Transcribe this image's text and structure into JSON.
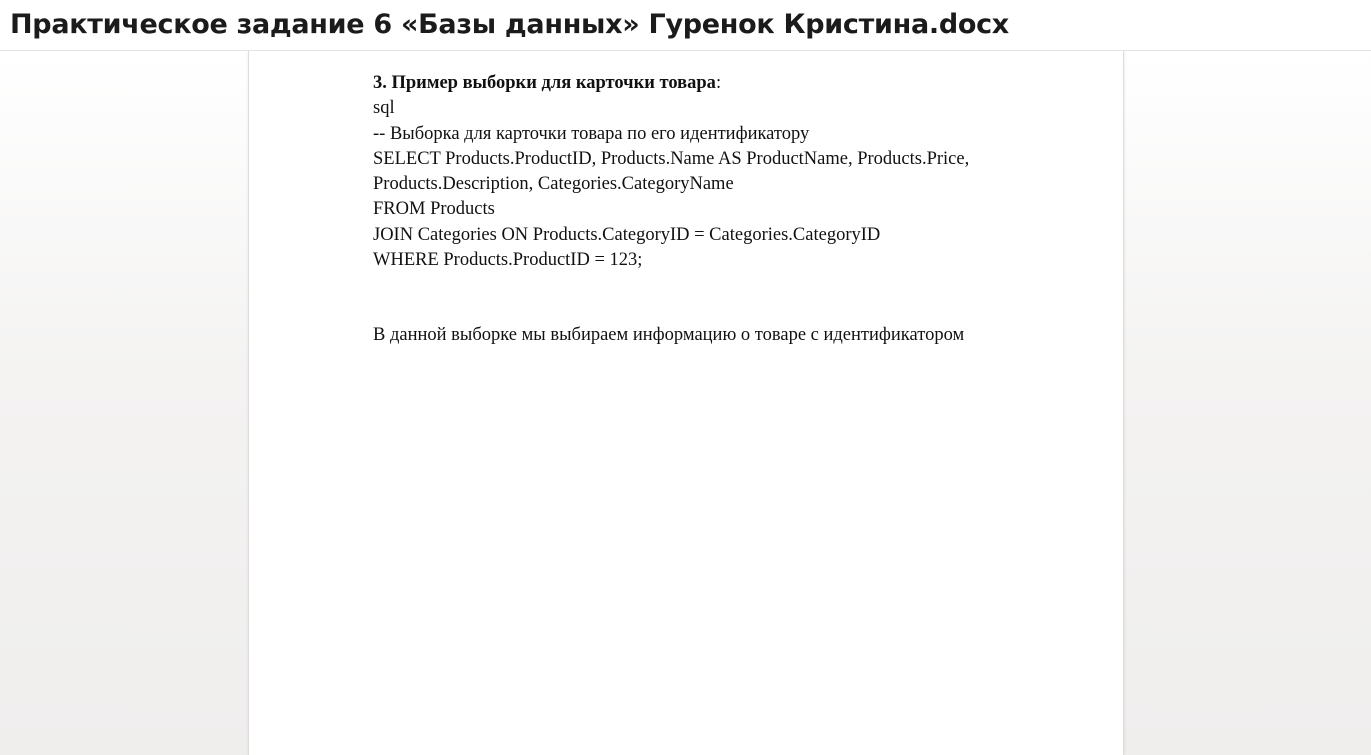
{
  "document": {
    "title": "Практическое задание 6 «Базы данных» Гуренок Кристина.docx"
  },
  "page": {
    "heading": {
      "bold": "3. Пример выборки для карточки товара",
      "suffix": ":"
    },
    "lines": [
      "sql",
      "-- Выборка для карточки товара по его идентификатору",
      "SELECT Products.ProductID, Products.Name AS ProductName, Products.Price,",
      "Products.Description, Categories.CategoryName",
      "FROM Products",
      "JOIN Categories ON Products.CategoryID = Categories.CategoryID",
      "WHERE Products.ProductID = 123;"
    ],
    "paragraph": "В данной выборке мы выбираем информацию о товаре с идентификатором"
  }
}
